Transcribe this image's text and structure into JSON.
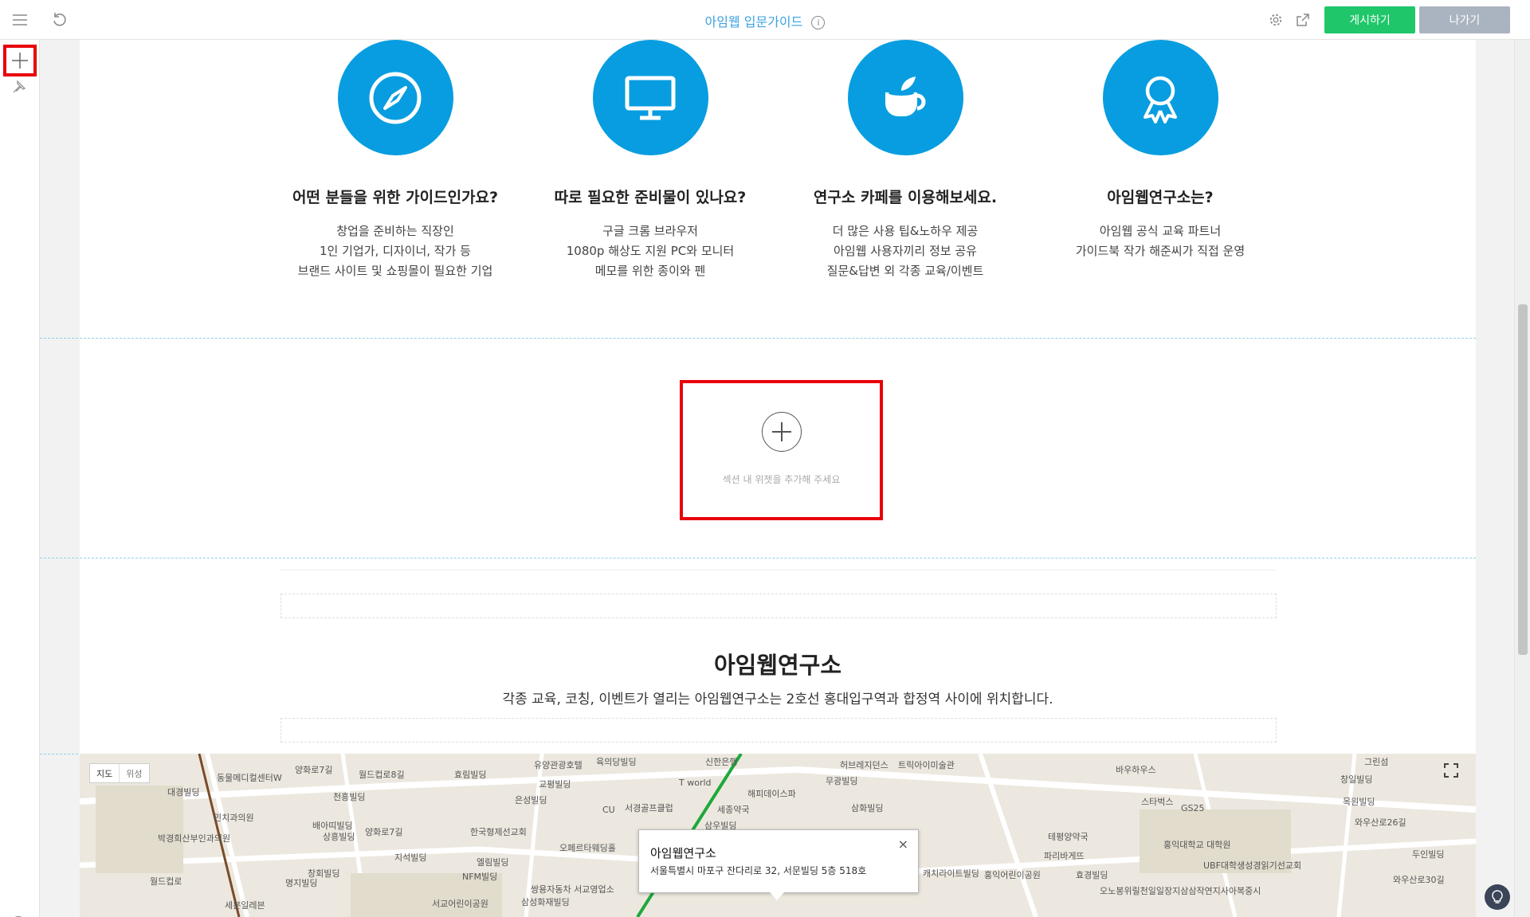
{
  "topbar": {
    "title": "아임웹 입문가이드",
    "info_glyph": "i",
    "publish_label": "게시하기",
    "exit_label": "나가기"
  },
  "features": [
    {
      "title": "어떤 분들을 위한 가이드인가요?",
      "lines": [
        "창업을 준비하는 직장인",
        "1인 기업가, 디자이너, 작가 등",
        "브랜드 사이트 및 쇼핑몰이 필요한 기업"
      ],
      "icon": "compass-icon"
    },
    {
      "title": "따로 필요한 준비물이 있나요?",
      "lines": [
        "구글 크롬 브라우저",
        "1080p 해상도 지원 PC와 모니터",
        "메모를 위한 종이와 펜"
      ],
      "icon": "monitor-icon"
    },
    {
      "title": "연구소 카페를 이용해보세요.",
      "lines": [
        "더 많은 사용 팁&노하우 제공",
        "아임웹 사용자끼리 정보 공유",
        "질문&답변 외 각종 교육/이벤트"
      ],
      "icon": "coffee-cup-icon"
    },
    {
      "title": "아임웹연구소는?",
      "lines": [
        "아임웹 공식 교육 파트너",
        "가이드북 작가 해준씨가 직접 운영"
      ],
      "icon": "award-ribbon-icon"
    }
  ],
  "empty_section": {
    "hint": "섹션 내 위젯을 추가해 주세요"
  },
  "location": {
    "title": "아임웹연구소",
    "description": "각종 교육, 코칭, 이벤트가 열리는 아임웹연구소는 2호선 홍대입구역과 합정역 사이에 위치합니다."
  },
  "map": {
    "toggle_map": "지도",
    "toggle_satellite": "위성",
    "popup_name": "아임웹연구소",
    "popup_address": "서울특별시 마포구 잔다리로 32, 서문빌딩 5층 518호",
    "popup_close": "×",
    "labels": [
      "양화로7길",
      "월드컵로8길",
      "효림빌딩",
      "유양관광호텔",
      "육의당빌딩",
      "신한은행",
      "허브레지던스",
      "트릭아이미술관",
      "바우하우스",
      "스타벅스",
      "그린섬",
      "창일빌딩",
      "목원빌딩",
      "와우산로26길",
      "홍익대학교 대학원",
      "파리바게뜨",
      "홍익어린이공원",
      "서교어린이공원",
      "명지빌딩",
      "세븐일레븐",
      "지석빌딩",
      "엘림빌딩",
      "NFM빌딩",
      "쌍용자동차 서교영업소",
      "삼성화재빌딩",
      "한국형제선교회",
      "오페르타웨딩홀",
      "서경골프클럽",
      "해피데이스파",
      "세종약국",
      "삼우빌딩",
      "삼화빌딩",
      "무광빌딩",
      "테평양약국",
      "캐치라이트빌딩",
      "효경빌딩",
      "UBF대학생성경읽기선교회",
      "오노봉위릴천일일장지삼삼작연지사아복중시",
      "두인빌딩",
      "와우산로30길",
      "동물메디컬센터W",
      "대경빌딩",
      "박경희산부인과의원",
      "민치과의원",
      "배아띠빌딩",
      "상흥빌딩",
      "천흥빌딩",
      "창회빌딩",
      "월드컵로",
      "양화로7길",
      "은성빌딩",
      "교평빌딩",
      "T world",
      "GS25",
      "CU"
    ]
  },
  "colors": {
    "accent": "#3aa3e3",
    "icon_circle": "#089de0",
    "publish": "#1fc66a",
    "exit": "#aab4c0",
    "highlight": "#e8000b"
  }
}
